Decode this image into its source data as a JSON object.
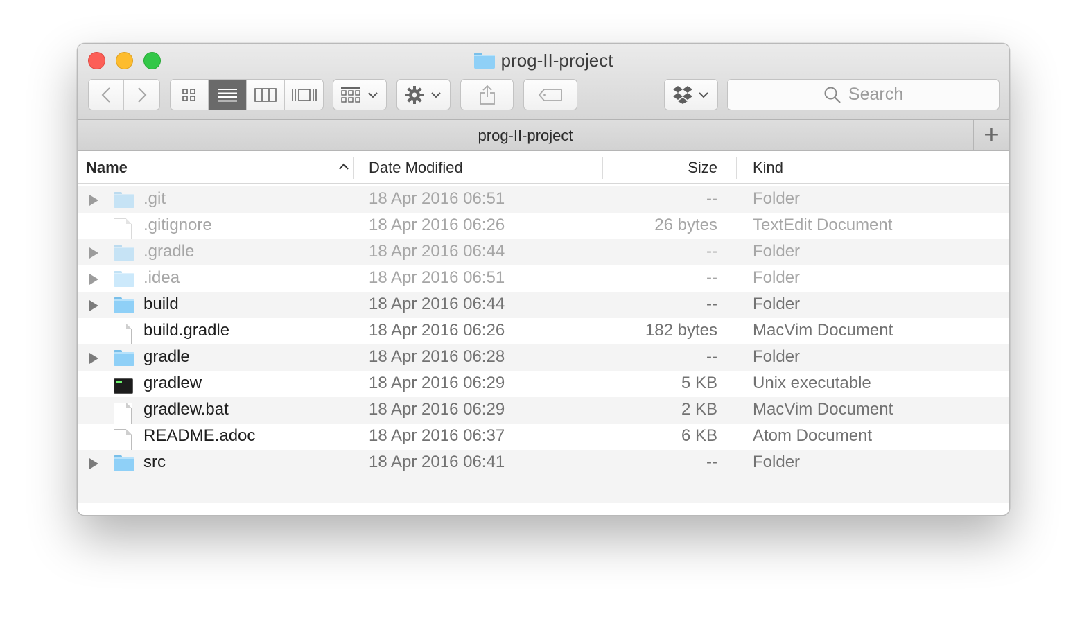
{
  "window": {
    "title": "prog-II-project"
  },
  "toolbar": {
    "search_placeholder": "Search"
  },
  "pathbar": {
    "title": "prog-II-project",
    "add_label": "+"
  },
  "columns": {
    "name": "Name",
    "date": "Date Modified",
    "size": "Size",
    "kind": "Kind"
  },
  "files": [
    {
      "name": ".git",
      "date": "18 Apr 2016 06:51",
      "size": "--",
      "kind": "Folder",
      "type": "folder",
      "hidden": true
    },
    {
      "name": ".gitignore",
      "date": "18 Apr 2016 06:26",
      "size": "26 bytes",
      "kind": "TextEdit Document",
      "type": "doc",
      "hidden": true
    },
    {
      "name": ".gradle",
      "date": "18 Apr 2016 06:44",
      "size": "--",
      "kind": "Folder",
      "type": "folder",
      "hidden": true
    },
    {
      "name": ".idea",
      "date": "18 Apr 2016 06:51",
      "size": "--",
      "kind": "Folder",
      "type": "folder",
      "hidden": true
    },
    {
      "name": "build",
      "date": "18 Apr 2016 06:44",
      "size": "--",
      "kind": "Folder",
      "type": "folder",
      "hidden": false
    },
    {
      "name": "build.gradle",
      "date": "18 Apr 2016 06:26",
      "size": "182 bytes",
      "kind": "MacVim Document",
      "type": "doc",
      "hidden": false
    },
    {
      "name": "gradle",
      "date": "18 Apr 2016 06:28",
      "size": "--",
      "kind": "Folder",
      "type": "folder",
      "hidden": false
    },
    {
      "name": "gradlew",
      "date": "18 Apr 2016 06:29",
      "size": "5 KB",
      "kind": "Unix executable",
      "type": "exec",
      "hidden": false
    },
    {
      "name": "gradlew.bat",
      "date": "18 Apr 2016 06:29",
      "size": "2 KB",
      "kind": "MacVim Document",
      "type": "doc",
      "hidden": false
    },
    {
      "name": "README.adoc",
      "date": "18 Apr 2016 06:37",
      "size": "6 KB",
      "kind": "Atom Document",
      "type": "doc",
      "hidden": false
    },
    {
      "name": "src",
      "date": "18 Apr 2016 06:41",
      "size": "--",
      "kind": "Folder",
      "type": "folder",
      "hidden": false
    }
  ],
  "colors": {
    "accent_active_segment": "#6a6a6a",
    "folder_blue": "#8fd0f7",
    "close": "#fc5f57",
    "minimize": "#fdbc2e",
    "maximize": "#33c748"
  }
}
